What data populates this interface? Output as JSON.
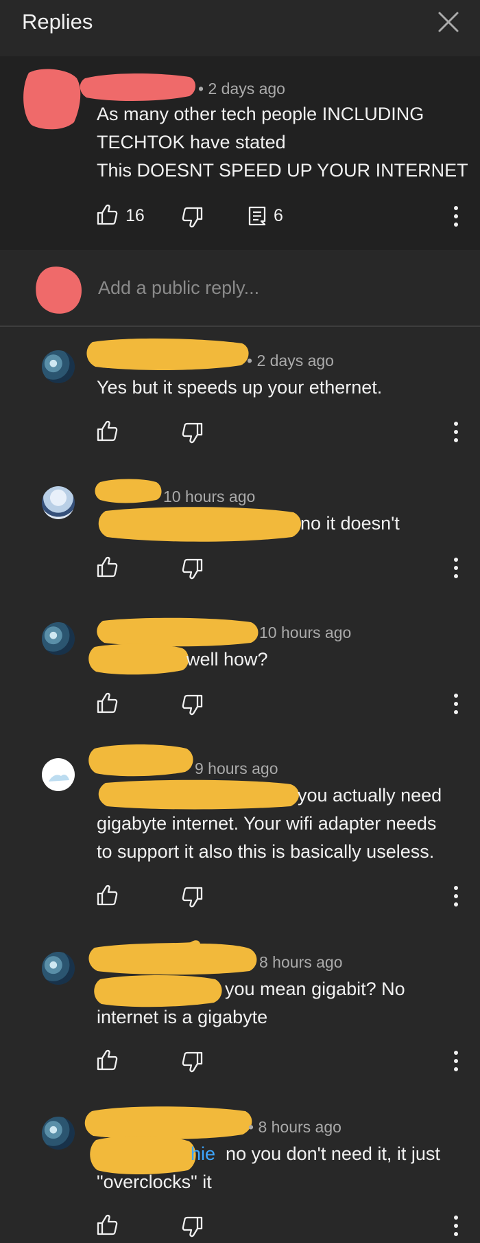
{
  "header": {
    "title": "Replies"
  },
  "parent_comment": {
    "meta": "• 2 days ago",
    "text_lines": [
      "As many other tech people INCLUDING",
      "TECHTOK have stated",
      "This DOESNT SPEED UP YOUR INTERNET"
    ],
    "likes": "16",
    "replies_count": "6"
  },
  "reply_box": {
    "placeholder": "Add a public reply..."
  },
  "replies": [
    {
      "meta": "• 2 days ago",
      "mention": "",
      "text_lines": [
        "Yes but it speeds up your ethernet."
      ]
    },
    {
      "meta": "10 hours ago",
      "mention": "",
      "text_lines": [
        "no it doesn't"
      ]
    },
    {
      "meta": "10 hours ago",
      "mention": "",
      "text_lines": [
        "well how?"
      ]
    },
    {
      "meta": "9 hours ago",
      "mention": "",
      "text_lines": [
        "you actually need",
        "gigabyte internet. Your wifi adapter needs",
        "to support it also this is basically useless."
      ]
    },
    {
      "meta": "8 hours ago",
      "mention": "",
      "text_lines": [
        "you mean gigabit? No",
        "internet is a gigabyte"
      ]
    },
    {
      "meta": "• 8 hours ago",
      "mention": "hie",
      "text_lines": [
        "no you don't need it, it just",
        "\"overclocks\" it"
      ]
    }
  ],
  "colors": {
    "background": "#282828",
    "parent_background": "#212121",
    "text": "#f1f1f1",
    "meta": "#aaaaaa",
    "mention": "#3ea6ff",
    "redaction_red": "#ef6a6a",
    "redaction_yellow": "#f2b93b"
  },
  "icons": [
    "close-icon",
    "thumbs-up-icon",
    "thumbs-down-icon",
    "reply-icon",
    "more-vert-icon"
  ]
}
